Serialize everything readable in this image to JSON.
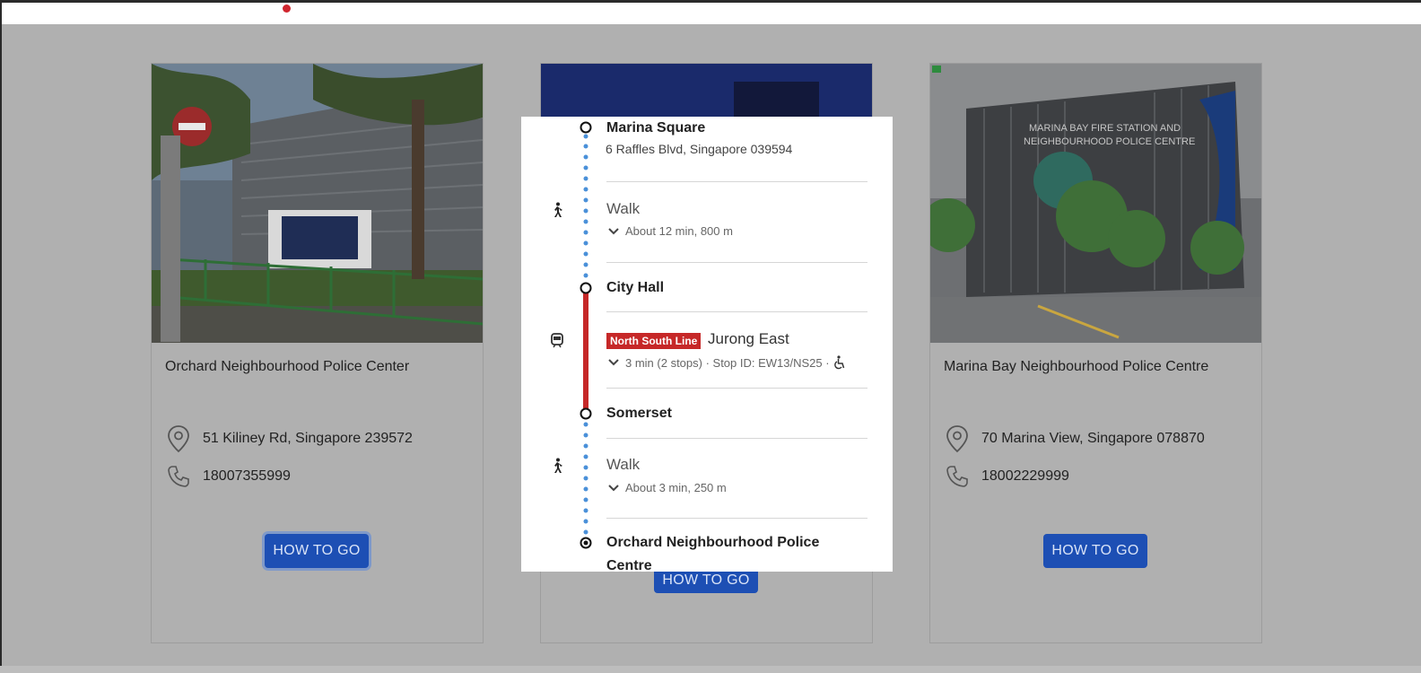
{
  "cards": [
    {
      "title": "Orchard Neighbourhood Police Center",
      "address": "51 Kiliney Rd, Singapore 239572",
      "phone": "18007355999",
      "button": "HOW TO GO"
    },
    {
      "button": "HOW TO GO"
    },
    {
      "title": "Marina Bay Neighbourhood Police Centre",
      "address": "70 Marina View, Singapore 078870",
      "phone": "18002229999",
      "button": "HOW TO GO"
    }
  ],
  "directions": {
    "origin": {
      "name": "Marina Square",
      "address": "6 Raffles Blvd, Singapore 039594"
    },
    "walk1": {
      "label": "Walk",
      "detail": "About 12 min, 800 m"
    },
    "stop1": {
      "name": "City Hall"
    },
    "transit": {
      "line": "North South Line",
      "line_color": "#c62828",
      "headsign": "Jurong East",
      "detail": "3 min (2 stops) · Stop ID: EW13/NS25 ·"
    },
    "stop2": {
      "name": "Somerset"
    },
    "walk2": {
      "label": "Walk",
      "detail": "About 3 min, 250 m"
    },
    "destination": {
      "name_line1": "Orchard Neighbourhood Police",
      "name_line2": "Centre"
    }
  },
  "icons": {
    "card_address": "location-pin-icon",
    "card_phone": "phone-icon",
    "walk": "walk-icon",
    "transit": "train-icon",
    "accessible": "wheelchair-icon",
    "expand": "chevron-down-icon"
  },
  "colors": {
    "button": "#1d4fb4",
    "walk_dots": "#4a90d9",
    "accent_dot": "#d0252e"
  }
}
